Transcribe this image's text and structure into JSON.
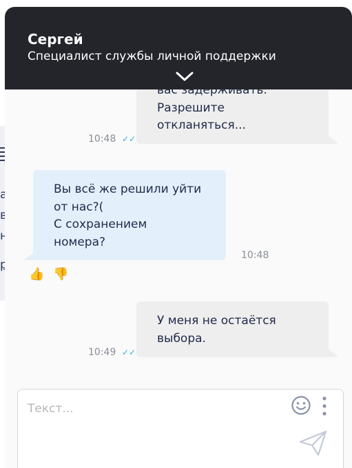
{
  "header": {
    "agent_name": "Сергей",
    "agent_role": "Специалист службы личной поддержки"
  },
  "background_page": {
    "letters": [
      "а",
      "в",
      "н",
      "р"
    ]
  },
  "messages": [
    {
      "direction": "outgoing",
      "lines": [
        "вас задерживать.",
        "Разрешите",
        "откланяться..."
      ],
      "time": "10:48",
      "status": "read"
    },
    {
      "direction": "incoming",
      "lines": [
        "Вы всё же решили уйти",
        "от нас?(",
        "С сохранением",
        "номера?"
      ],
      "time": "10:48",
      "rating": {
        "like_icon": "👍",
        "dislike_icon": "👎"
      }
    },
    {
      "direction": "outgoing",
      "lines": [
        "У меня не остаётся",
        "выбора."
      ],
      "time": "10:49",
      "status": "read"
    }
  ],
  "composer": {
    "placeholder": "Текст...",
    "value": ""
  },
  "colors": {
    "header_bg": "#23252b",
    "outgoing_bubble": "#eeeeee",
    "incoming_bubble": "#e3f0fc",
    "read_check": "#2bb0d6",
    "text": "#1f2a4a"
  }
}
